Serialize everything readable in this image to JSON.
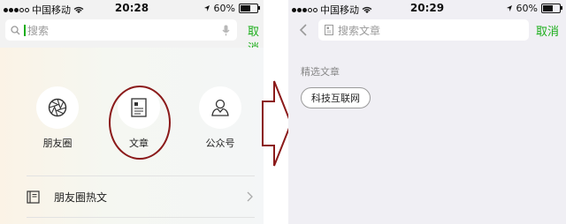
{
  "left_screen": {
    "status": {
      "carrier": "中国移动",
      "time": "20:28",
      "battery": "60%",
      "battery_level": 0.6
    },
    "search": {
      "placeholder": "搜索",
      "cancel_label": "取消"
    },
    "categories": [
      {
        "label": "朋友圈",
        "icon": "aperture-icon"
      },
      {
        "label": "文章",
        "icon": "document-icon"
      },
      {
        "label": "公众号",
        "icon": "person-icon"
      }
    ],
    "list": [
      {
        "label": "朋友圈热文",
        "icon": "book-icon"
      }
    ],
    "accent_color": "#1aad19",
    "highlight_color": "#8b1a1a"
  },
  "right_screen": {
    "status": {
      "carrier": "中国移动",
      "time": "20:29",
      "battery": "60%",
      "battery_level": 0.6
    },
    "search": {
      "placeholder": "搜索文章",
      "cancel_label": "取消"
    },
    "section_label": "精选文章",
    "tags": [
      "科技互联网"
    ]
  }
}
